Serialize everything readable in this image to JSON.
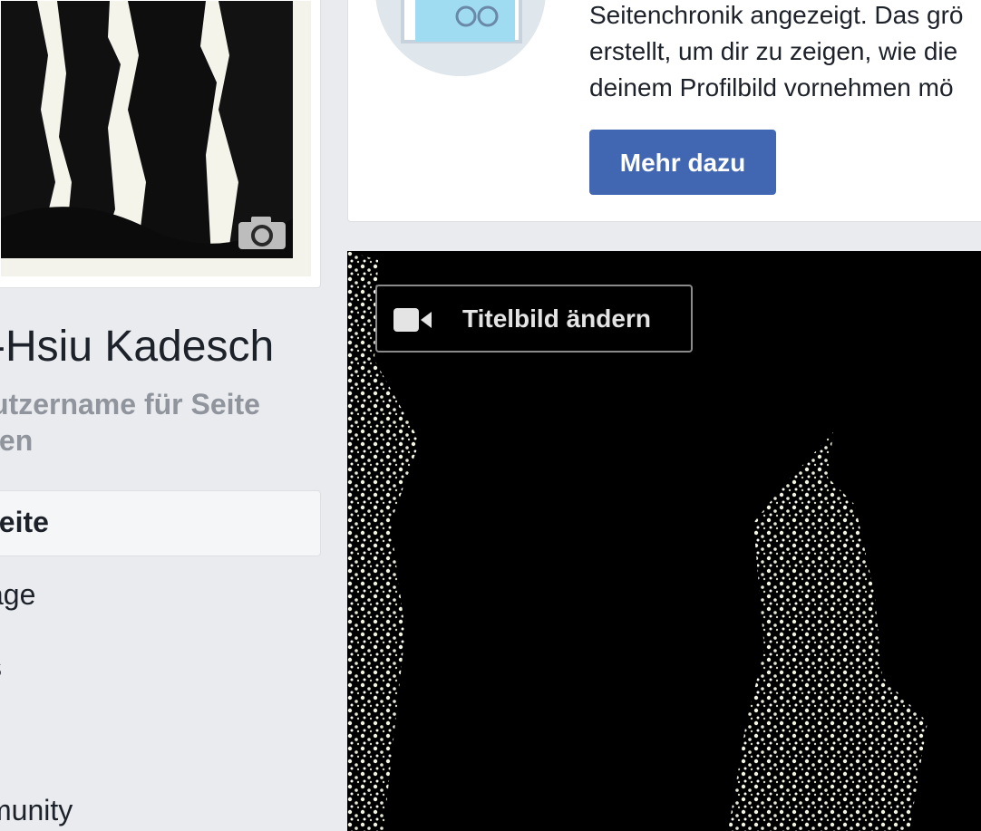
{
  "profile": {
    "name": "-Hsiu Kadesch",
    "username_link": "utzername für Seite\nlen",
    "photo_icon": "camera-icon"
  },
  "nav": {
    "active_label": "seite",
    "items": [
      "äge",
      "s",
      "munity"
    ]
  },
  "info_card": {
    "lines": [
      "Seitenchronik angezeigt. Das grö",
      "erstellt, um dir zu zeigen, wie die",
      "deinem Profilbild vornehmen mö"
    ],
    "button_label": "Mehr dazu",
    "button_color": "#4267b2"
  },
  "cover": {
    "button_label": "Titelbild ändern",
    "button_icon": "video-camera-icon"
  }
}
